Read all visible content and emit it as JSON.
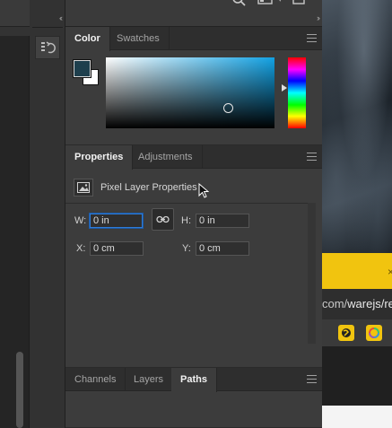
{
  "top_strip": {
    "left_collapse": "‹‹",
    "right_collapse": "››",
    "workspace_caret": "▾"
  },
  "color_panel": {
    "tabs": [
      {
        "label": "Color",
        "active": true
      },
      {
        "label": "Swatches",
        "active": false
      }
    ],
    "foreground_color": "#1e3f4d",
    "background_color": "#ffffff",
    "field_hue_color": "#12a2e4"
  },
  "properties_panel": {
    "tabs": [
      {
        "label": "Properties",
        "active": true
      },
      {
        "label": "Adjustments",
        "active": false
      }
    ],
    "header_label": "Pixel Layer Properties",
    "fields": {
      "w_label": "W:",
      "w_value": "0 in",
      "h_label": "H:",
      "h_value": "0 in",
      "x_label": "X:",
      "x_value": "0 cm",
      "y_label": "Y:",
      "y_value": "0 cm"
    }
  },
  "paths_panel": {
    "tabs": [
      {
        "label": "Channels",
        "active": false
      },
      {
        "label": "Layers",
        "active": false
      },
      {
        "label": "Paths",
        "active": true
      }
    ]
  },
  "browser": {
    "url_prefix": "com/",
    "url_rest": "warejs/re",
    "close_glyph": "×",
    "banner_color": "#f1c40f"
  }
}
